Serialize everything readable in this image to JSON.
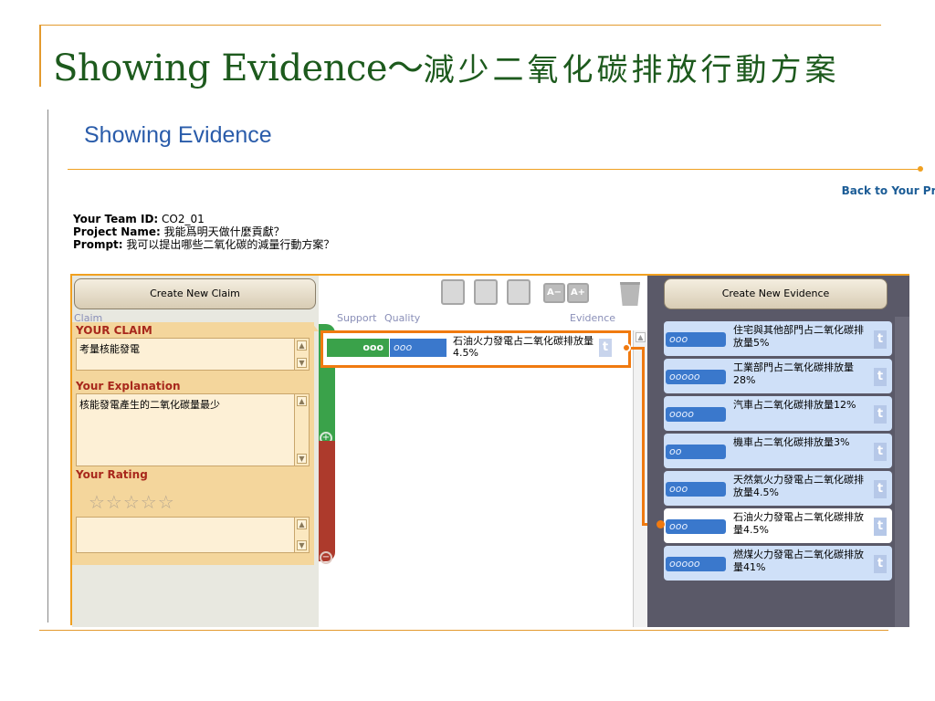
{
  "slide": {
    "title_en": "Showing Evidence～",
    "title_cn": "減少二氧化碳排放行動方案"
  },
  "app": {
    "heading": "Showing Evidence",
    "back_link": "Back to Your Projects",
    "team_id_label": "Your Team ID:",
    "team_id": "CO2_01",
    "project_label": "Project Name:",
    "project_name": "我能爲明天做什麼貢獻？",
    "prompt_label": "Prompt:",
    "prompt": "我可以提出哪些二氧化碳的減量行動方案？"
  },
  "claim_panel": {
    "create_button": "Create New Claim",
    "col_label": "Claim",
    "claim_title": "YOUR CLAIM",
    "claim_text": "考量核能發電",
    "explanation_title": "Your Explanation",
    "explanation_text": "核能發電產生的二氧化碳量最少",
    "rating_title": "Your Rating",
    "rating_stars": "☆☆☆☆☆",
    "rating_value": 0,
    "rating_comment": ""
  },
  "middle": {
    "col_support": "Support",
    "col_quality": "Quality",
    "col_evidence": "Evidence",
    "linked": {
      "support_mark": "ooo",
      "quality_mark": "ooo",
      "text": "石油火力發電占二氧化碳排放量4.5%",
      "t": "t"
    },
    "tools": {
      "font_smaller": "A−",
      "font_larger": "A+"
    }
  },
  "evidence_panel": {
    "create_button": "Create New Evidence",
    "items": [
      {
        "quality": "ooo",
        "text": "住宅與其他部門占二氧化碳排放量5%",
        "t": "t"
      },
      {
        "quality": "ooooo",
        "text": "工業部門占二氧化碳排放量28%",
        "t": "t"
      },
      {
        "quality": "oooo",
        "text": "汽車占二氧化碳排放量12%",
        "t": "t"
      },
      {
        "quality": "oo",
        "text": "機車占二氧化碳排放量3%",
        "t": "t"
      },
      {
        "quality": "ooo",
        "text": "天然氣火力發電占二氧化碳排放量4.5%",
        "t": "t"
      },
      {
        "quality": "ooo",
        "text": "石油火力發電占二氧化碳排放量4.5%",
        "t": "t"
      },
      {
        "quality": "ooooo",
        "text": "燃煤火力發電占二氧化碳排放量41%",
        "t": "t"
      }
    ]
  },
  "colors": {
    "slide_title": "#1d5a1d",
    "accent_orange": "#f0a020",
    "support_green": "#3aa24a",
    "oppose_red": "#ad3a2c",
    "quality_blue": "#3a78cc",
    "evidence_bg": "#5a5968"
  }
}
